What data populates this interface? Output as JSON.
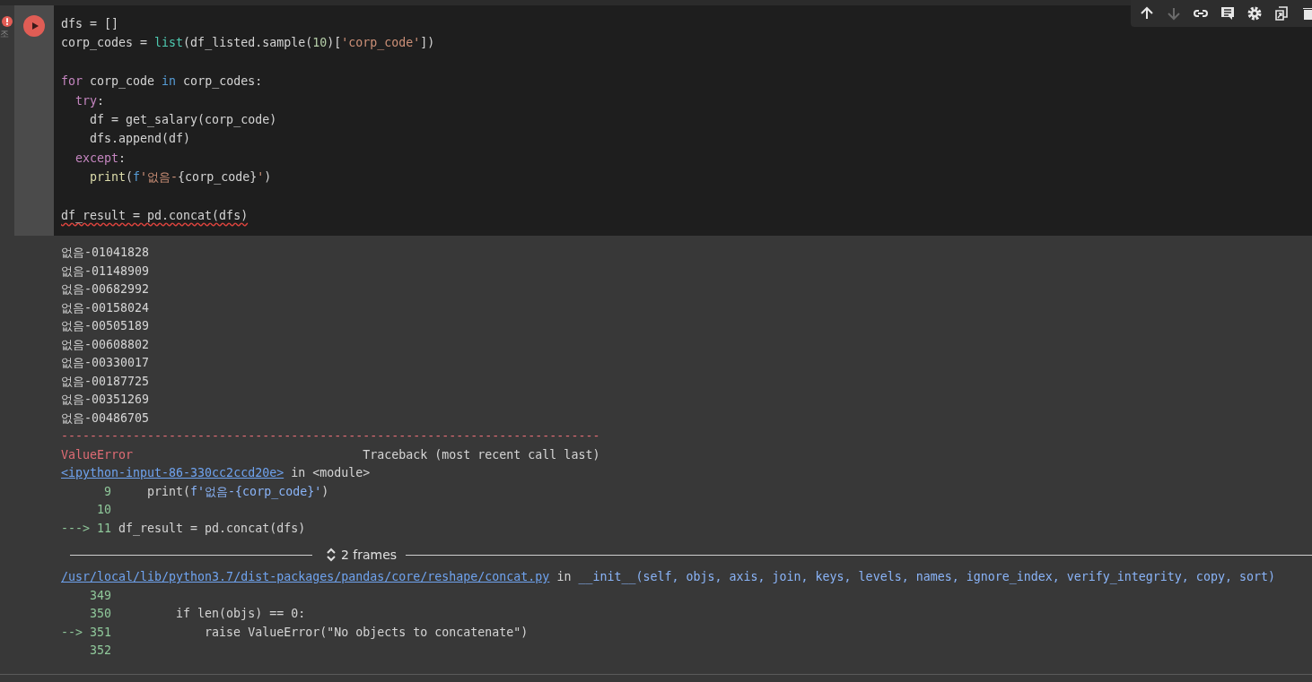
{
  "toolbar": [
    {
      "kind": "up",
      "disabled": false
    },
    {
      "kind": "down",
      "disabled": true
    },
    {
      "kind": "link",
      "disabled": false
    },
    {
      "kind": "comment",
      "disabled": false
    },
    {
      "kind": "settings",
      "disabled": false
    },
    {
      "kind": "mirror",
      "disabled": false
    },
    {
      "kind": "delete",
      "disabled": false
    }
  ],
  "cell": {
    "error": true,
    "status_text": "조",
    "code": [
      {
        "kind": "code",
        "tokens": [
          {
            "kind": "plain",
            "t": "dfs = []"
          }
        ]
      },
      {
        "kind": "code",
        "tokens": [
          {
            "kind": "plain",
            "t": "corp_codes = "
          },
          {
            "kind": "builtin",
            "t": "list"
          },
          {
            "kind": "plain",
            "t": "(df_listed.sample("
          },
          {
            "kind": "number",
            "t": "10"
          },
          {
            "kind": "plain",
            "t": ")["
          },
          {
            "kind": "string",
            "t": "'corp_code'"
          },
          {
            "kind": "plain",
            "t": "])"
          }
        ]
      },
      {
        "kind": "blank"
      },
      {
        "kind": "code",
        "tokens": [
          {
            "kind": "keyword",
            "t": "for"
          },
          {
            "kind": "plain",
            "t": " corp_code "
          },
          {
            "kind": "operator",
            "t": "in"
          },
          {
            "kind": "plain",
            "t": " corp_codes:"
          }
        ]
      },
      {
        "kind": "code",
        "tokens": [
          {
            "kind": "keyword",
            "t": "  try"
          },
          {
            "kind": "plain",
            "t": ":"
          }
        ]
      },
      {
        "kind": "code",
        "tokens": [
          {
            "kind": "plain",
            "t": "    df = get_salary(corp_code)"
          }
        ]
      },
      {
        "kind": "code",
        "tokens": [
          {
            "kind": "plain",
            "t": "    dfs.append(df)"
          }
        ]
      },
      {
        "kind": "code",
        "tokens": [
          {
            "kind": "keyword",
            "t": "  except"
          },
          {
            "kind": "plain",
            "t": ":"
          }
        ]
      },
      {
        "kind": "code",
        "tokens": [
          {
            "kind": "function",
            "t": "    print"
          },
          {
            "kind": "plain",
            "t": "("
          },
          {
            "kind": "operator",
            "t": "f"
          },
          {
            "kind": "string",
            "t": "'없음-"
          },
          {
            "kind": "plain",
            "t": "{corp_code}"
          },
          {
            "kind": "string",
            "t": "'"
          },
          {
            "kind": "plain",
            "t": ")"
          }
        ]
      },
      {
        "kind": "blank"
      },
      {
        "kind": "code",
        "flagged": true,
        "tokens": [
          {
            "kind": "plain",
            "t": "df_result = pd.concat(dfs)"
          }
        ]
      }
    ]
  },
  "output": {
    "lines": [
      "없음-01041828",
      "없음-01148909",
      "없음-00682992",
      "없음-00158024",
      "없음-00505189",
      "없음-00608802",
      "없음-00330017",
      "없음-00187725",
      "없음-00351269",
      "없음-00486705"
    ],
    "traceback": {
      "rule": "---------------------------------------------------------------------------",
      "error_name": "ValueError",
      "heading": "Traceback (most recent call last)",
      "frames": [
        {
          "kind": "frame",
          "link": "<ipython-input-86-330cc2ccd20e>",
          "where": " in <module>",
          "lines": [
            {
              "number": "9",
              "tokens": [
                {
                  "kind": "plain",
                  "t": "    print("
                },
                {
                  "kind": "link-code",
                  "t": "f'없음-{corp_code}'"
                },
                {
                  "kind": "plain",
                  "t": ")"
                }
              ]
            },
            {
              "number": "10"
            },
            {
              "number": "11",
              "marker": "--->",
              "tokens": [
                {
                  "kind": "plain",
                  "t": "df_result = pd.concat(dfs)"
                }
              ]
            }
          ]
        },
        {
          "kind": "divider",
          "label": "2 frames"
        },
        {
          "kind": "frame",
          "link": "/usr/local/lib/python3.7/dist-packages/pandas/core/reshape/concat.py",
          "where": " in ",
          "call": "__init__(self, objs, axis, join, keys, levels, names, ignore_index, verify_integrity, copy, sort)",
          "lines": [
            {
              "number": "349"
            },
            {
              "number": "350",
              "tokens": [
                {
                  "kind": "plain",
                  "t": "        if len(objs) == 0:"
                }
              ]
            },
            {
              "number": "351",
              "marker": "-->",
              "tokens": [
                {
                  "kind": "plain",
                  "t": "            raise ValueError(\"No objects to concatenate\")"
                }
              ]
            },
            {
              "number": "352"
            }
          ]
        }
      ]
    }
  }
}
